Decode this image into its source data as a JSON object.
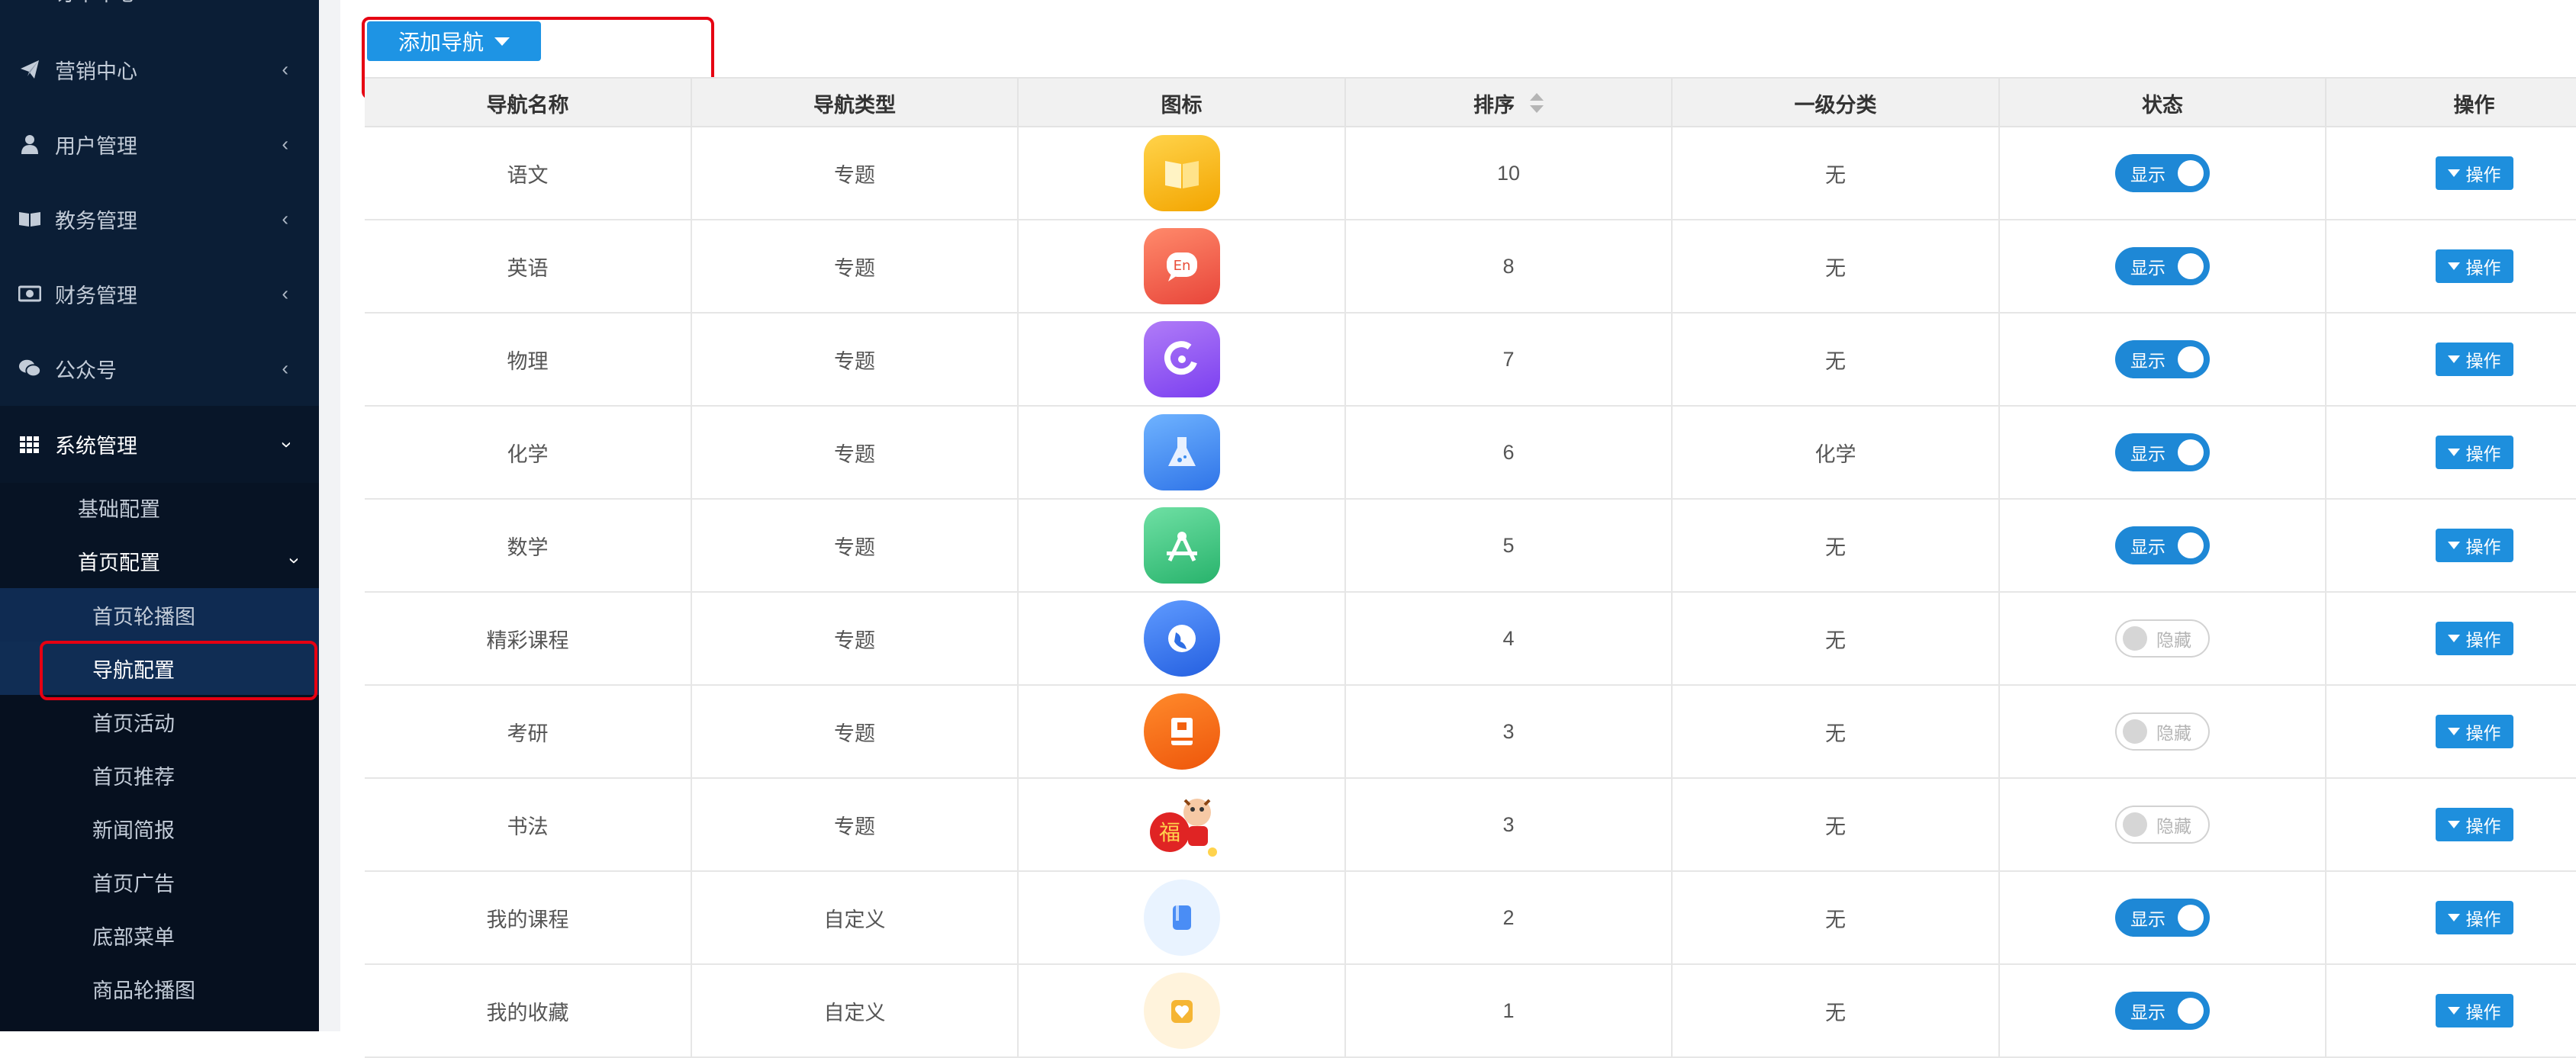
{
  "sidebar": {
    "items": [
      {
        "label": "订单中心",
        "icon": "list-icon"
      },
      {
        "label": "营销中心",
        "icon": "paper-plane-icon"
      },
      {
        "label": "用户管理",
        "icon": "user-icon"
      },
      {
        "label": "教务管理",
        "icon": "book-icon"
      },
      {
        "label": "财务管理",
        "icon": "money-icon"
      },
      {
        "label": "公众号",
        "icon": "wechat-icon"
      },
      {
        "label": "系统管理",
        "icon": "grid-icon"
      }
    ],
    "system_sub": [
      "基础配置",
      "首页配置"
    ],
    "home_config_sub": [
      "首页轮播图",
      "导航配置",
      "首页活动",
      "首页推荐",
      "新闻简报",
      "首页广告",
      "底部菜单",
      "商品轮播图"
    ]
  },
  "toolbar": {
    "add_label": "添加导航"
  },
  "table": {
    "headers": [
      "导航名称",
      "导航类型",
      "图标",
      "排序",
      "一级分类",
      "状态",
      "操作"
    ],
    "rows": [
      {
        "name": "语文",
        "type": "专题",
        "icon": "book-open-icon",
        "icon_color": "#f5b400",
        "sort": "10",
        "category": "无",
        "status": "显示",
        "on": true,
        "op": "操作"
      },
      {
        "name": "英语",
        "type": "专题",
        "icon": "english-chat-icon",
        "icon_color": "#f0614a",
        "sort": "8",
        "category": "无",
        "status": "显示",
        "on": true,
        "op": "操作"
      },
      {
        "name": "物理",
        "type": "专题",
        "icon": "magnet-icon",
        "icon_color": "#8b4fe6",
        "sort": "7",
        "category": "无",
        "status": "显示",
        "on": true,
        "op": "操作"
      },
      {
        "name": "化学",
        "type": "专题",
        "icon": "flask-icon",
        "icon_color": "#3d8ef0",
        "sort": "6",
        "category": "化学",
        "status": "显示",
        "on": true,
        "op": "操作"
      },
      {
        "name": "数学",
        "type": "专题",
        "icon": "compass-icon",
        "icon_color": "#35c07a",
        "sort": "5",
        "category": "无",
        "status": "显示",
        "on": true,
        "op": "操作"
      },
      {
        "name": "精彩课程",
        "type": "专题",
        "icon": "globe-icon",
        "icon_color": "#2f6fe4",
        "sort": "4",
        "category": "无",
        "status": "隐藏",
        "on": false,
        "op": "操作"
      },
      {
        "name": "考研",
        "type": "专题",
        "icon": "study-book-icon",
        "icon_color": "#f2610f",
        "sort": "3",
        "category": "无",
        "status": "隐藏",
        "on": false,
        "op": "操作"
      },
      {
        "name": "书法",
        "type": "专题",
        "icon": "fu-ox-icon",
        "icon_color": "#e02424",
        "sort": "3",
        "category": "无",
        "status": "隐藏",
        "on": false,
        "op": "操作"
      },
      {
        "name": "我的课程",
        "type": "自定义",
        "icon": "bookmark-icon",
        "icon_color": "#3b82f6",
        "sort": "2",
        "category": "无",
        "status": "显示",
        "on": true,
        "op": "操作"
      },
      {
        "name": "我的收藏",
        "type": "自定义",
        "icon": "heart-icon",
        "icon_color": "#f5a623",
        "sort": "1",
        "category": "无",
        "status": "显示",
        "on": true,
        "op": "操作"
      }
    ]
  },
  "colors": {
    "sidebar_bg": "#0b1e36",
    "accent": "#1e8fdd",
    "highlight": "#e60012"
  }
}
